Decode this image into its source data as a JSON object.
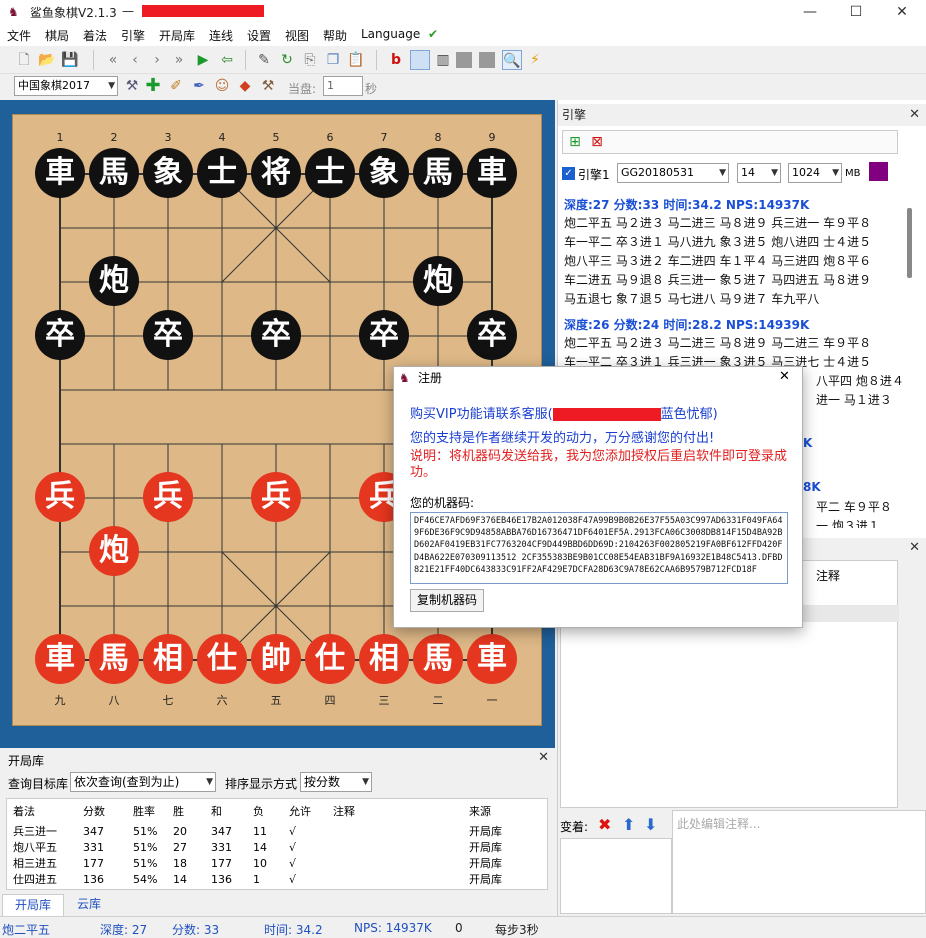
{
  "window": {
    "title": "鲨鱼象棋V2.1.3",
    "title_suffix": "—",
    "minimize": "—",
    "maximize": "☐",
    "close": "✕"
  },
  "menu": [
    "文件",
    "棋局",
    "着法",
    "引擎",
    "开局库",
    "连线",
    "设置",
    "视图",
    "帮助",
    "Language"
  ],
  "toolbar2": {
    "game_type": "中国象棋2017",
    "current_label": "当盘:",
    "current_value": "1",
    "seconds_label": "秒"
  },
  "board": {
    "col_numbers_top": [
      "1",
      "2",
      "3",
      "4",
      "5",
      "6",
      "7",
      "8",
      "9"
    ],
    "col_numbers_bottom": [
      "九",
      "八",
      "七",
      "六",
      "五",
      "四",
      "三",
      "二",
      "一"
    ],
    "black_top": [
      "車",
      "馬",
      "象",
      "士",
      "将",
      "士",
      "象",
      "馬",
      "車"
    ],
    "black_cannons": [
      "炮",
      "炮"
    ],
    "black_pawns": [
      "卒",
      "卒",
      "卒",
      "卒",
      "卒"
    ],
    "red_pawns": [
      "兵",
      "兵",
      "兵",
      "兵"
    ],
    "red_cannon": "炮",
    "red_bottom": [
      "車",
      "馬",
      "相",
      "仕",
      "帥",
      "仕",
      "相",
      "馬",
      "車"
    ]
  },
  "engine": {
    "panel_title": "引擎",
    "enabled_label": "引擎1",
    "engine_name": "GG20180531",
    "threads": "14",
    "hash": "1024",
    "hash_unit": "MB",
    "color": "#800080",
    "blocks": [
      {
        "header": "深度:27 分数:33 时间:34.2 NPS:14937K",
        "lines": [
          "炮二平五 马２进３ 马二进三 马８进９ 兵三进一 车９平８",
          "车一平二 卒３进１ 马八进九 象３进５ 炮八进四 士４进５",
          "炮八平三 马３进２ 车二进四 车１平４ 马三进四 炮８平６",
          "车二进五 马９退８ 兵三进一 象５进７ 马四进五 马８进９",
          "马五退七 象７退５ 马七进八 马９进７ 车九平八"
        ]
      },
      {
        "header": "深度:26 分数:24 时间:28.2 NPS:14939K",
        "lines": [
          "炮二平五 马２进３ 马二进三 马８进９ 马二进三 车９平８",
          "车一平二 卒３进１ 兵三进一 象３进５ 马三进七 士４进５",
          "",
          "",
          "",
          ""
        ]
      }
    ],
    "partial": [
      "K",
      "8K",
      "3K"
    ],
    "partial_lines": [
      "八平四 炮８进４",
      "进一 马１进３",
      "平二 车９平８",
      "一 炮３进１"
    ]
  },
  "dialog": {
    "title": "注册",
    "close": "✕",
    "line1_prefix": "购买VIP功能请联系客服(",
    "line1_suffix": "蓝色忧郁)",
    "line2": "您的支持是作者继续开发的动力，万分感谢您的付出!",
    "line3": "说明：将机器码发送给我，我为您添加授权后重启软件即可登录成功。",
    "machine_label": "您的机器码:",
    "machine_code": "DF46CE7AFD69F376EB46E17B2A012038F47A99B9B0B26E37F55A03C997AD6331F049FA649F6DE36F9C9D94858ABBA76D16736471DF6401EF5A.2913FCA06C3008DB814F15D4BA92BD602AF0419EB31FC7763204CF9D449BBD6DD69D:2104263F002805219FA0BF612FFD420FD4BA622E070309113512 2CF355383BE9B01CC08E54EAB31BF9A16932E1B48C5413.DFBD821E21FF40DC643833C91FF2AF429E7DCFA28D63C9A78E62CAA6B9579B712FCD18F",
    "copy_button": "复制机器码"
  },
  "move_panel": {
    "note_header": "注释",
    "variation_label": "变着:",
    "note_placeholder": "此处编辑注释..."
  },
  "opening": {
    "title": "开局库",
    "query_label": "查询目标库",
    "query_value": "依次查询(查到为止)",
    "sort_label": "排序显示方式",
    "sort_value": "按分数",
    "headers": [
      "着法",
      "分数",
      "胜率",
      "胜",
      "和",
      "负",
      "允许",
      "注释",
      "来源"
    ],
    "rows": [
      [
        "兵三进一",
        "347",
        "51%",
        "20",
        "347",
        "11",
        "√",
        "",
        "开局库"
      ],
      [
        "炮八平五",
        "331",
        "51%",
        "27",
        "331",
        "14",
        "√",
        "",
        "开局库"
      ],
      [
        "相三进五",
        "177",
        "51%",
        "18",
        "177",
        "10",
        "√",
        "",
        "开局库"
      ],
      [
        "仕四进五",
        "136",
        "54%",
        "14",
        "136",
        "1",
        "√",
        "",
        "开局库"
      ]
    ],
    "tabs": [
      "开局库",
      "云库"
    ]
  },
  "status": {
    "move": "炮二平五",
    "depth": "深度: 27",
    "score": "分数: 33",
    "time": "时间: 34.2",
    "nps": "NPS: 14937K",
    "zero": "0",
    "per_step": "每步3秒"
  }
}
